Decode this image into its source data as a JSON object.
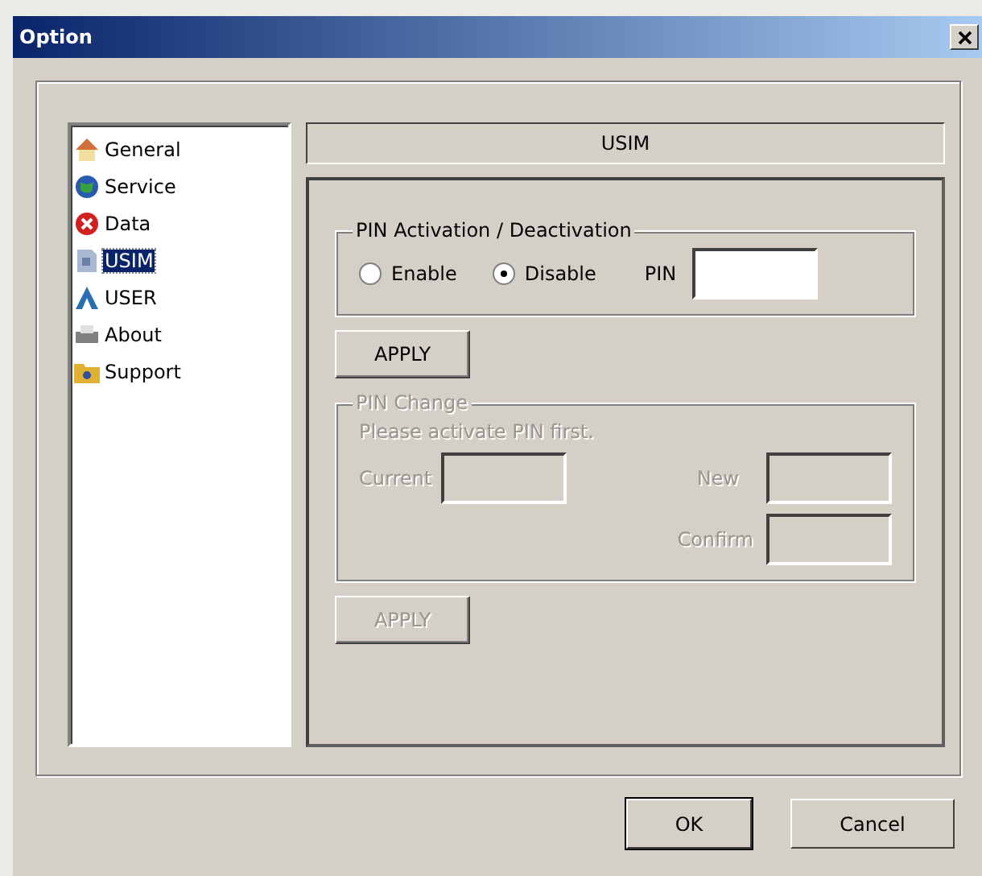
{
  "window": {
    "title": "Option"
  },
  "sidebar": {
    "items": [
      {
        "label": "General",
        "kind": "house",
        "selected": false
      },
      {
        "label": "Service",
        "kind": "globe",
        "selected": false
      },
      {
        "label": "Data",
        "kind": "stop",
        "selected": false
      },
      {
        "label": "USIM",
        "kind": "card",
        "selected": true
      },
      {
        "label": "USER",
        "kind": "letter",
        "selected": false
      },
      {
        "label": "About",
        "kind": "printer",
        "selected": false
      },
      {
        "label": "Support",
        "kind": "folder",
        "selected": false
      }
    ]
  },
  "header": "USIM",
  "pin_activation": {
    "title": "PIN Activation / Deactivation",
    "disabled": false,
    "options": [
      {
        "label": "Enable",
        "selected": false
      },
      {
        "label": "Disable",
        "selected": true
      }
    ],
    "pin_label": "PIN",
    "apply": "APPLY"
  },
  "pin_change": {
    "title": "PIN Change",
    "disabled": true,
    "hint": "Please activate PIN first.",
    "current_label": "Current",
    "new_label": "New",
    "confirm_label": "Confirm",
    "apply": "APPLY"
  },
  "buttons": [
    {
      "label": "OK",
      "default": true
    },
    {
      "label": "Cancel",
      "default": false
    }
  ]
}
